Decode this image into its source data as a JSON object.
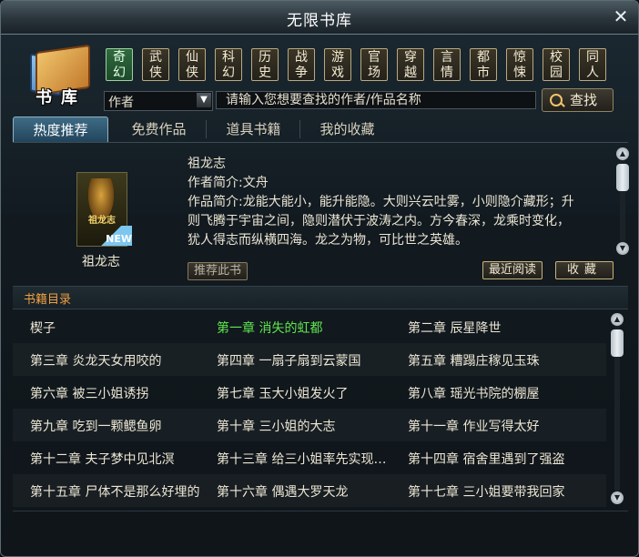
{
  "window": {
    "title": "无限书库",
    "close_icon": "close-icon"
  },
  "logo": {
    "char1": "书",
    "char2": "库"
  },
  "genres": [
    {
      "l1": "奇",
      "l2": "幻",
      "active": true
    },
    {
      "l1": "武",
      "l2": "侠",
      "active": false
    },
    {
      "l1": "仙",
      "l2": "侠",
      "active": false
    },
    {
      "l1": "科",
      "l2": "幻",
      "active": false
    },
    {
      "l1": "历",
      "l2": "史",
      "active": false
    },
    {
      "l1": "战",
      "l2": "争",
      "active": false
    },
    {
      "l1": "游",
      "l2": "戏",
      "active": false
    },
    {
      "l1": "官",
      "l2": "场",
      "active": false
    },
    {
      "l1": "穿",
      "l2": "越",
      "active": false
    },
    {
      "l1": "言",
      "l2": "情",
      "active": false
    },
    {
      "l1": "都",
      "l2": "市",
      "active": false
    },
    {
      "l1": "惊",
      "l2": "悚",
      "active": false
    },
    {
      "l1": "校",
      "l2": "园",
      "active": false
    },
    {
      "l1": "同",
      "l2": "人",
      "active": false
    }
  ],
  "search": {
    "type_value": "作者",
    "placeholder": "请输入您想要查找的作者/作品名称",
    "button_label": "查找"
  },
  "tabs": [
    {
      "label": "热度推荐",
      "active": true
    },
    {
      "label": "免费作品",
      "active": false
    },
    {
      "label": "道具书籍",
      "active": false
    },
    {
      "label": "我的收藏",
      "active": false
    }
  ],
  "book": {
    "cover_title": "祖龙志",
    "cover_badge": "NEW",
    "name": "祖龙志",
    "title_line": "祖龙志",
    "author_line": "作者简介:文舟",
    "desc_line1": "作品简介:龙能大能小，能升能隐。大则兴云吐雾，小则隐介藏形；升",
    "desc_line2": "则飞腾于宇宙之间，隐则潜伏于波涛之内。方今春深，龙乘时变化，",
    "desc_line3": "犹人得志而纵横四海。龙之为物，可比世之英雄。",
    "recommend_label": "推荐此书",
    "recent_label": "最近阅读",
    "fav_label": "收藏"
  },
  "chapters_title": "书籍目录",
  "chapters": [
    [
      "楔子",
      "第一章  消失的虹都",
      "第二章  辰星降世"
    ],
    [
      "第三章  炎龙天女用咬的",
      "第四章  一扇子扇到云蒙国",
      "第五章  糟蹋庄稼见玉珠"
    ],
    [
      "第六章  被三小姐诱拐",
      "第七章  玉大小姐发火了",
      "第八章  瑶光书院的棚屋"
    ],
    [
      "第九章  吃到一颗鳃鱼卵",
      "第十章  三小姐的大志",
      "第十一章  作业写得太好"
    ],
    [
      "第十二章  夫子梦中见北溟",
      "第十三章  给三小姐率先实现…",
      "第十四章  宿舍里遇到了强盗"
    ],
    [
      "第十五章  尸体不是那么好埋的",
      "第十六章  偶遇大罗天龙",
      "第十七章  三小姐要带我回家"
    ]
  ],
  "highlighted_chapter": "第一章  消失的虹都",
  "colors": {
    "accent_green": "#5ee64e",
    "section_title": "#f0a040",
    "tab_active": "#22455c"
  }
}
